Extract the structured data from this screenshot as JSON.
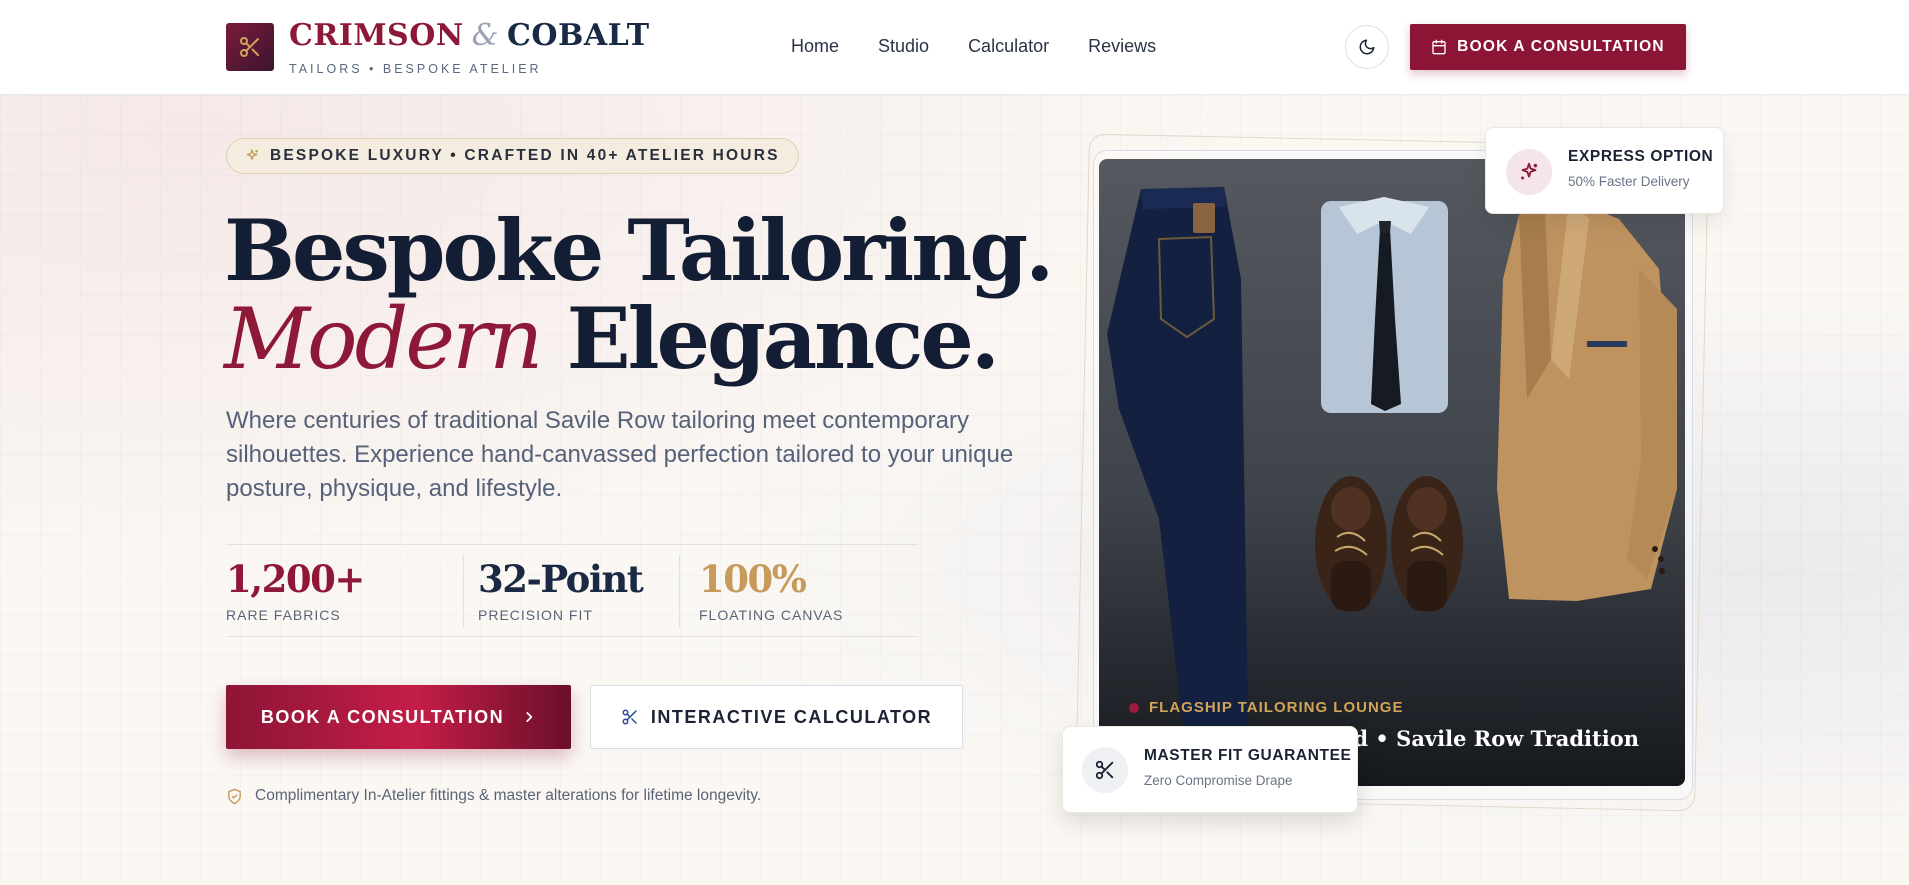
{
  "header": {
    "brand_primary": "CRIMSON",
    "brand_amp": "&",
    "brand_secondary": "COBALT",
    "brand_tagline": "TAILORS • BESPOKE ATELIER",
    "nav": [
      {
        "label": "Home"
      },
      {
        "label": "Studio"
      },
      {
        "label": "Calculator"
      },
      {
        "label": "Reviews"
      }
    ],
    "theme_toggle_icon": "moon-icon",
    "cta_label": "BOOK A CONSULTATION",
    "cta_icon": "calendar-icon"
  },
  "hero": {
    "badge": "BESPOKE LUXURY • CRAFTED IN 40+ ATELIER HOURS",
    "badge_icon": "sparkle-icon",
    "headline_line1": "Bespoke Tailoring.",
    "headline_accent": "Modern",
    "headline_line2_rest": "Elegance.",
    "lead": "Where centuries of traditional Savile Row tailoring meet contemporary silhouettes. Experience hand-canvassed perfection tailored to your unique posture, physique, and lifestyle.",
    "stats": [
      {
        "value": "1,200+",
        "label": "RARE FABRICS",
        "color": "#8e1838"
      },
      {
        "value": "32-Point",
        "label": "PRECISION FIT",
        "color": "#1a2a44"
      },
      {
        "value": "100%",
        "label": "FLOATING CANVAS",
        "color": "#c79a5a"
      }
    ],
    "primary_button": "BOOK A CONSULTATION",
    "secondary_button": "INTERACTIVE CALCULATOR",
    "note": "Complimentary In-Atelier fittings & master alterations for lifetime longevity."
  },
  "showcase": {
    "tag": "FLAGSHIP TAILORING LOUNGE",
    "caption": "assed • Savile Row Tradition",
    "express_title": "EXPRESS OPTION",
    "express_sub": "50% Faster Delivery",
    "guarantee_title": "MASTER FIT GUARANTEE",
    "guarantee_sub": "Zero Compromise Drape"
  },
  "colors": {
    "crimson": "#8e1838",
    "cobalt": "#1a2a44",
    "gold": "#c79a5a"
  }
}
